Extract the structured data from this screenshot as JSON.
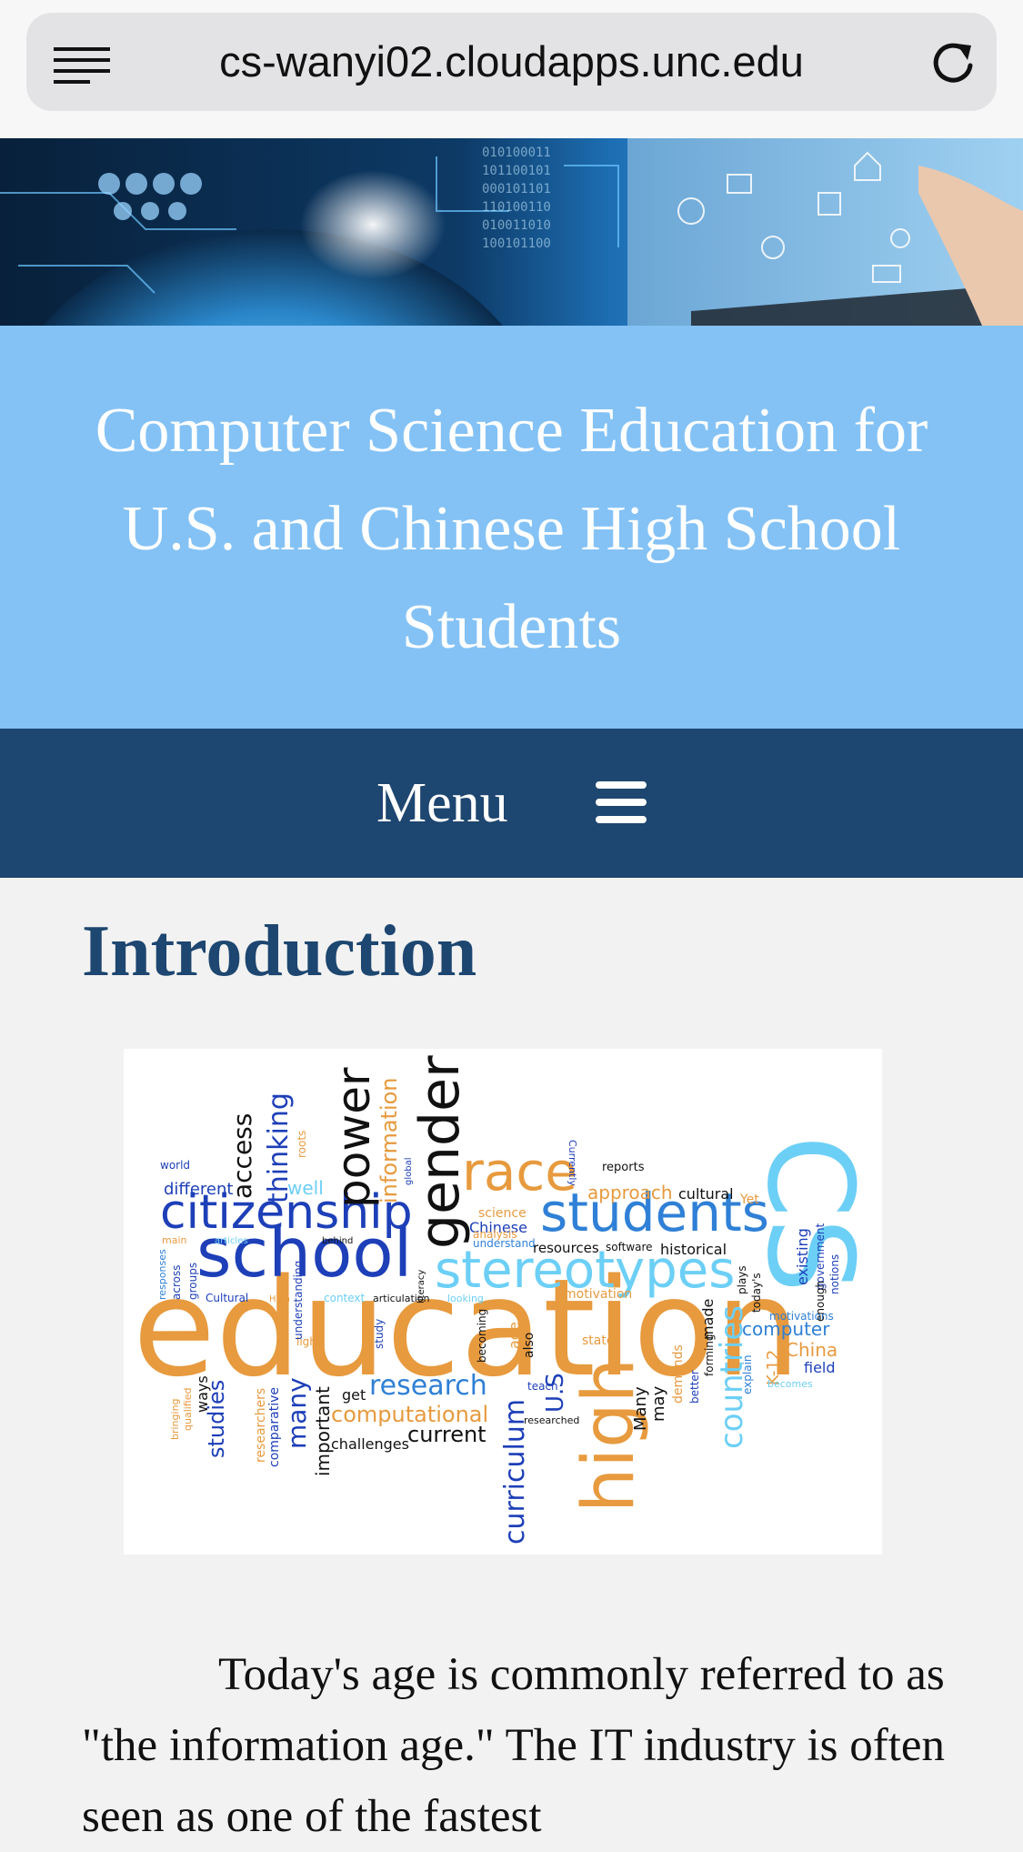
{
  "browser": {
    "url": "cs-wanyi02.cloudapps.unc.edu",
    "reader_icon": "reader-mode-icon",
    "reload_icon": "reload-icon"
  },
  "header": {
    "title": "Computer Science Education for U.S. and Chinese High School Students"
  },
  "nav": {
    "menu_label": "Menu",
    "menu_icon": "hamburger-icon"
  },
  "main": {
    "heading": "Introduction",
    "paragraph": "Today's age is commonly referred to as \"the information age.\" The IT industry is often seen as one of the fastest"
  },
  "wordcloud": {
    "words": [
      "education",
      "school",
      "citizenship",
      "students",
      "stereotypes",
      "race",
      "gender",
      "power",
      "thinking",
      "access",
      "information",
      "research",
      "computational",
      "curriculum",
      "high",
      "countries",
      "CS",
      "current",
      "different",
      "well",
      "cultural",
      "approach",
      "science",
      "Chinese",
      "computer",
      "China",
      "field",
      "U.S",
      "Many",
      "may",
      "studies",
      "many",
      "important",
      "comparative",
      "researchers",
      "challenges",
      "get",
      "existing",
      "government",
      "motivations",
      "historical",
      "resources",
      "software",
      "reports",
      "Currently",
      "world",
      "main",
      "articles",
      "behind",
      "articulation",
      "looking",
      "motivation",
      "state",
      "also",
      "age",
      "becoming",
      "study",
      "teach",
      "researched",
      "ways",
      "qualified",
      "bringing",
      "High",
      "light",
      "today's",
      "plays",
      "Yet",
      "K-12",
      "explain",
      "becomes",
      "made",
      "demands",
      "better",
      "forming",
      "literacy",
      "context",
      "understand",
      "analysis",
      "roots",
      "global",
      "Cultural",
      "across",
      "groups",
      "responses",
      "enough",
      "notions",
      "understanding"
    ]
  },
  "colors": {
    "title_band": "#84c2f5",
    "nav_bar": "#1d4670",
    "heading": "#1d4670",
    "page_bg": "#f2f2f2"
  }
}
